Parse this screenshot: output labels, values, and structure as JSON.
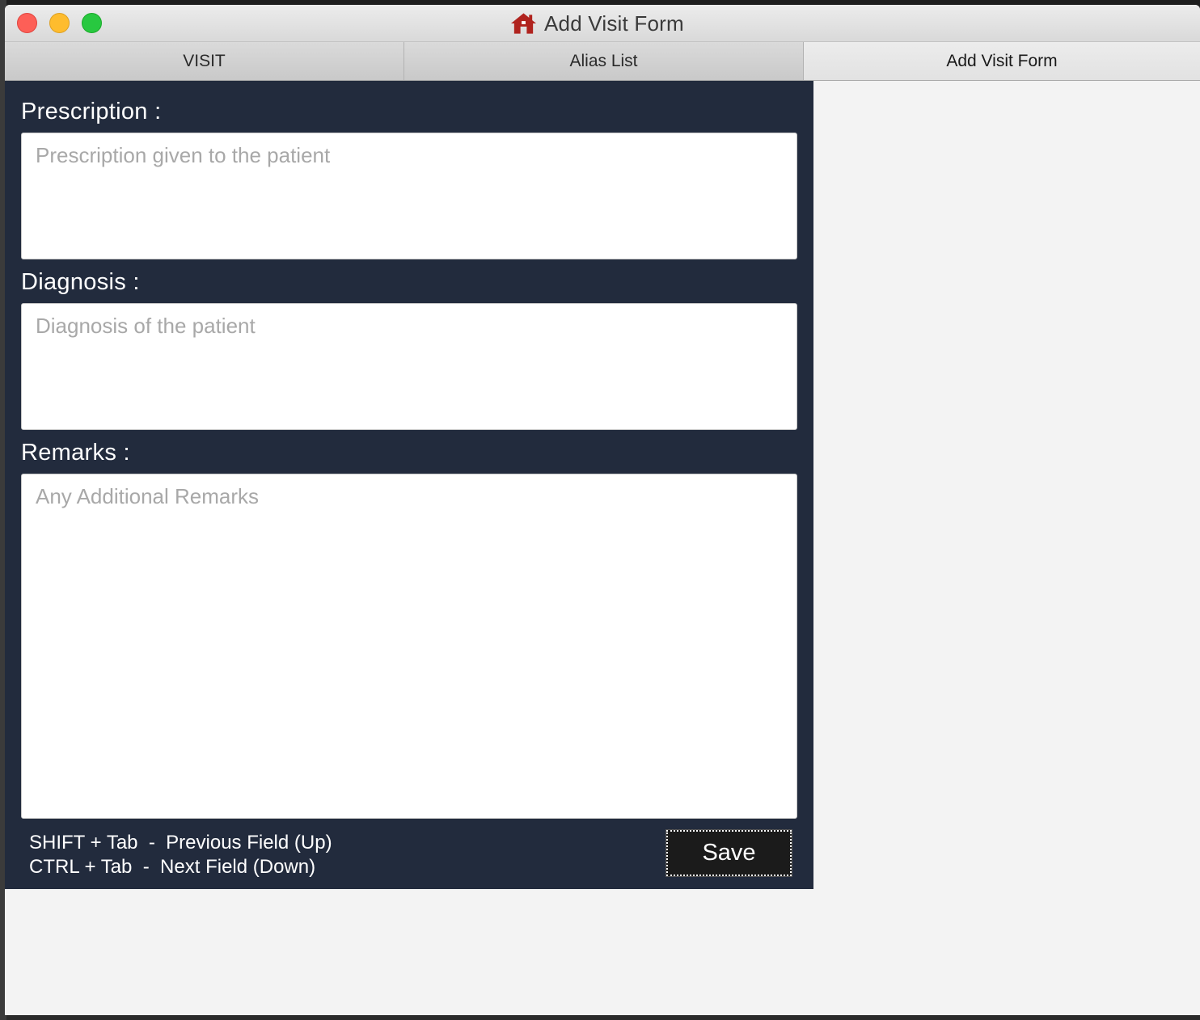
{
  "window": {
    "title": "Add Visit Form",
    "title_icon": "home-icon"
  },
  "tabs": [
    {
      "label": "VISIT"
    },
    {
      "label": "Alias List"
    },
    {
      "label": "Add Visit Form",
      "selected": true
    }
  ],
  "form": {
    "prescription": {
      "label": "Prescription :",
      "value": "",
      "placeholder": "Prescription given to the patient"
    },
    "diagnosis": {
      "label": "Diagnosis :",
      "value": "",
      "placeholder": "Diagnosis of the patient"
    },
    "remarks": {
      "label": "Remarks :",
      "value": "",
      "placeholder": "Any Additional Remarks"
    },
    "shortcuts": {
      "line1": "SHIFT + Tab  -  Previous Field (Up)",
      "line2": "CTRL + Tab  -  Next Field (Down)"
    },
    "save_label": "Save"
  },
  "colors": {
    "panel_bg": "#222b3d",
    "save_bg": "#1b1b1b",
    "home_icon": "#b0231e"
  }
}
